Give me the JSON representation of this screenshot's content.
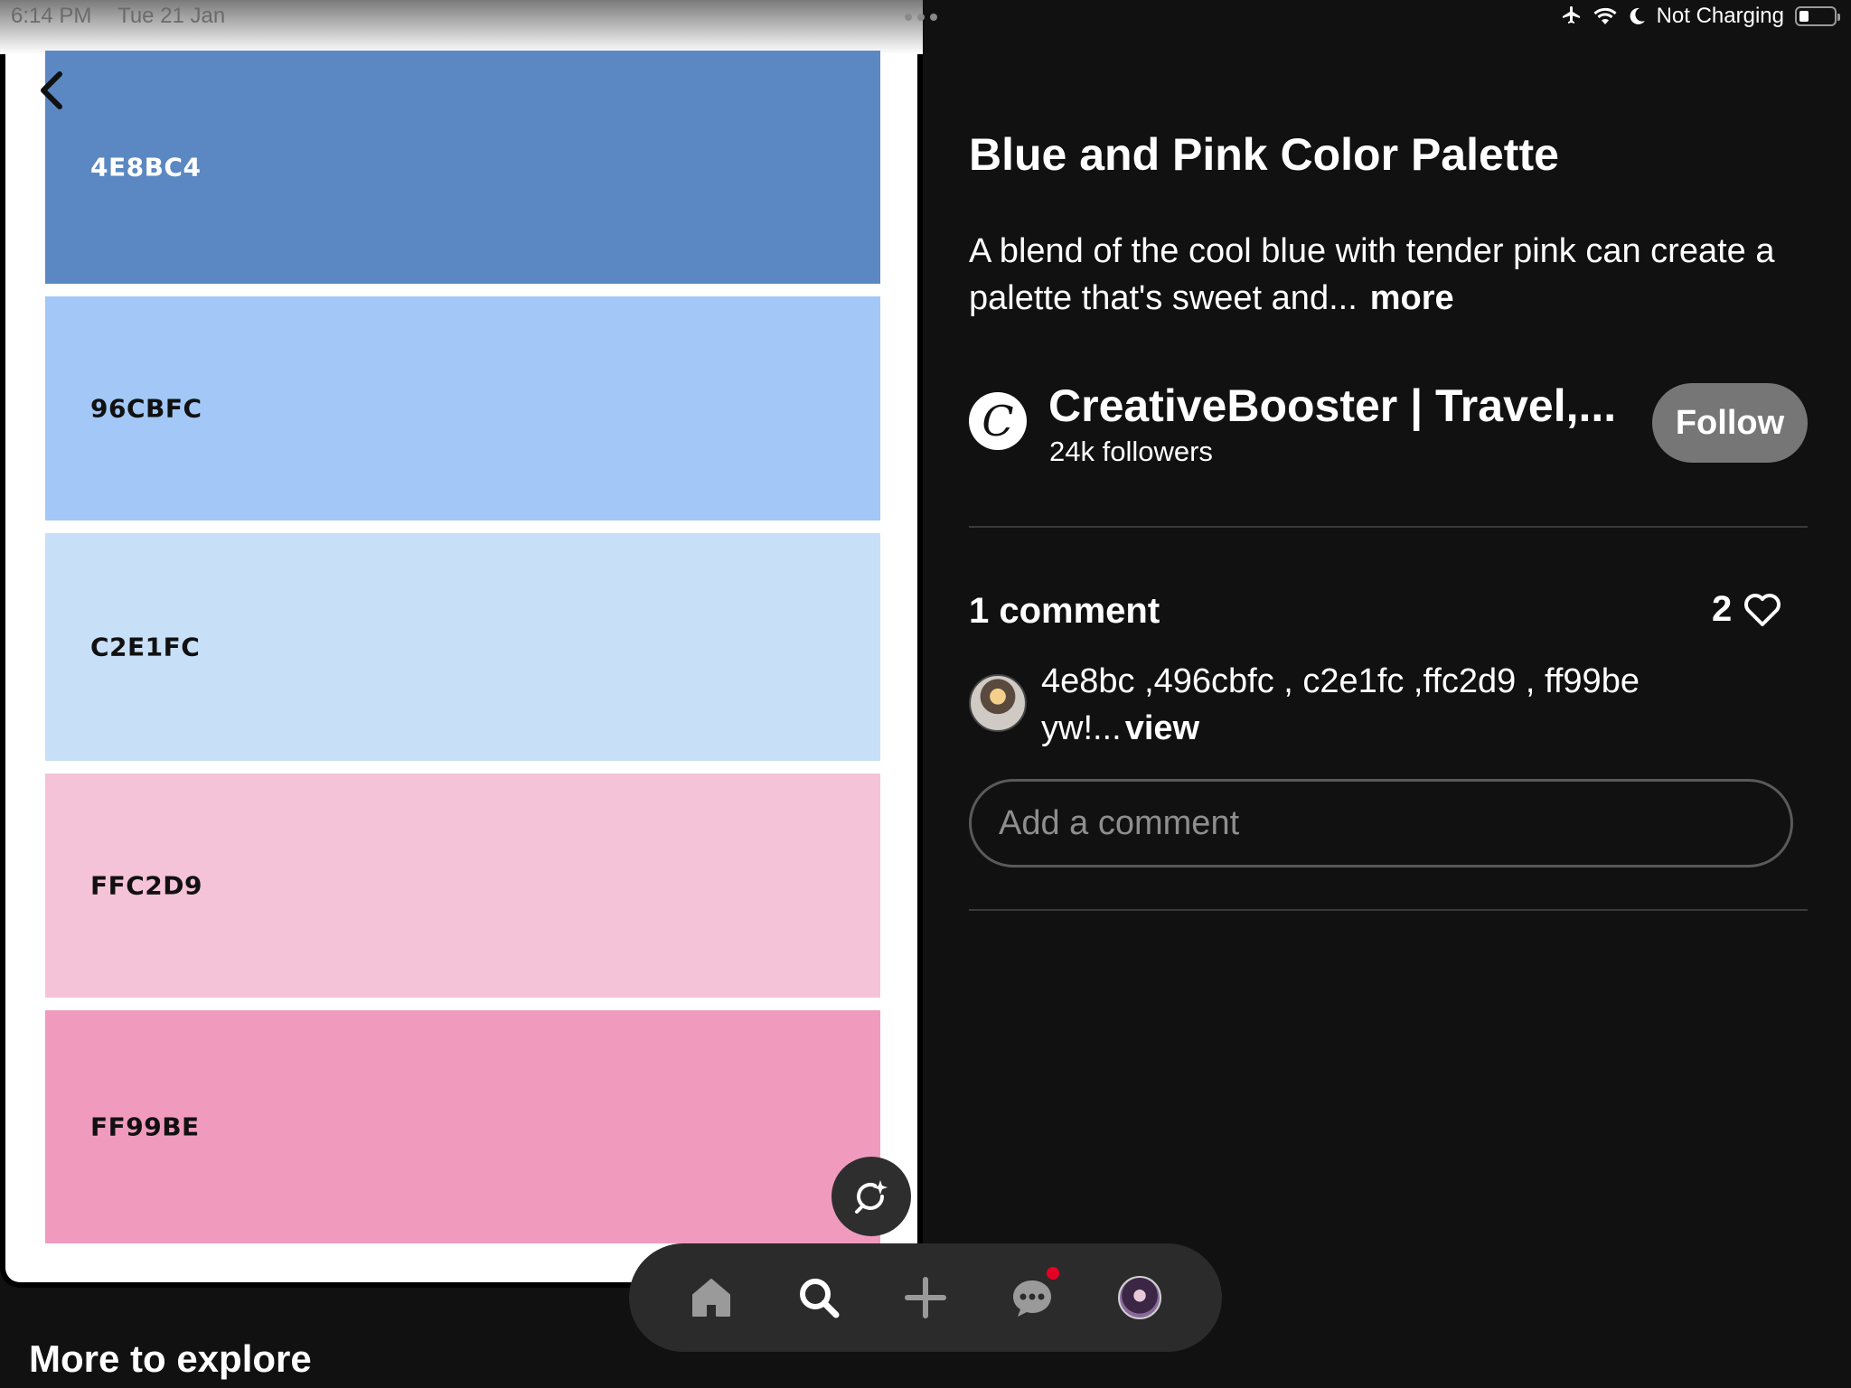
{
  "status_bar": {
    "time": "6:14 PM",
    "date": "Tue 21 Jan",
    "charging_status": "Not Charging",
    "icons": [
      "airplane-icon",
      "wifi-icon",
      "moon-icon",
      "battery-icon"
    ]
  },
  "palette": {
    "swatches": [
      {
        "label": "4E8BC4",
        "color": "#5b88c2",
        "text_color": "#ffffff"
      },
      {
        "label": "96CBFC",
        "color": "#a3c8f7",
        "text_color": "#111111"
      },
      {
        "label": "C2E1FC",
        "color": "#c8dff8",
        "text_color": "#111111"
      },
      {
        "label": "FFC2D9",
        "color": "#f5c3d8",
        "text_color": "#111111"
      },
      {
        "label": "FF99BE",
        "color": "#f09bbd",
        "text_color": "#111111"
      }
    ]
  },
  "pin": {
    "title": "Blue and Pink Color Palette",
    "description": "A blend of the cool blue with tender pink can create a palette that's sweet and...",
    "more_label": "more"
  },
  "creator": {
    "avatar_letter": "C",
    "name": "CreativeBooster | Travel,...",
    "followers": "24k followers",
    "follow_label": "Follow"
  },
  "comments": {
    "title": "1 comment",
    "like_count": "2",
    "items": [
      {
        "text": "4e8bc ,496cbfc , c2e1fc ,ffc2d9 , ff99be yw!...",
        "view_label": "view"
      }
    ],
    "input_placeholder": "Add a comment"
  },
  "explore": {
    "title": "More to explore"
  },
  "tab_bar": {
    "items": [
      "home-icon",
      "search-icon",
      "plus-icon",
      "messages-icon",
      "profile-avatar"
    ],
    "accent": "#e60023"
  }
}
